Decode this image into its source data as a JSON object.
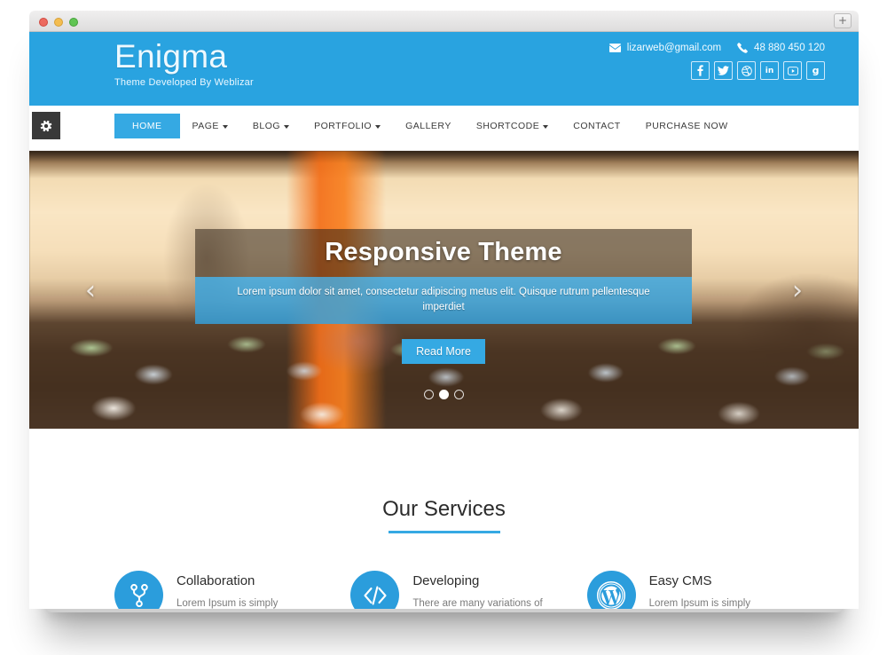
{
  "browser": {
    "traffic_lights": [
      "close",
      "minimize",
      "zoom"
    ],
    "new_tab_label": "+"
  },
  "site_header": {
    "brand_title": "Enigma",
    "brand_tagline": "Theme Developed By Weblizar",
    "email": "lizarweb@gmail.com",
    "phone": "48 880 450 120",
    "email_icon": "envelope-icon",
    "phone_icon": "phone-icon",
    "background_color": "#29a3e0",
    "social": [
      {
        "name": "facebook",
        "glyph": "f"
      },
      {
        "name": "twitter",
        "glyph": "t"
      },
      {
        "name": "dribbble",
        "glyph": "d"
      },
      {
        "name": "linkedin",
        "glyph": "in"
      },
      {
        "name": "youtube",
        "glyph": "y"
      },
      {
        "name": "googleplus",
        "glyph": "g"
      }
    ]
  },
  "nav": {
    "gear_icon": "gear-icon",
    "items": [
      {
        "label": "HOME",
        "active": true,
        "caret": false
      },
      {
        "label": "PAGE",
        "active": false,
        "caret": true
      },
      {
        "label": "BLOG",
        "active": false,
        "caret": true
      },
      {
        "label": "PORTFOLIO",
        "active": false,
        "caret": true
      },
      {
        "label": "GALLERY",
        "active": false,
        "caret": false
      },
      {
        "label": "SHORTCODE",
        "active": false,
        "caret": true
      },
      {
        "label": "CONTACT",
        "active": false,
        "caret": false
      },
      {
        "label": "PURCHASE NOW",
        "active": false,
        "caret": false
      }
    ],
    "active_color": "#35a9e3"
  },
  "hero": {
    "title": "Responsive Theme",
    "subtitle": "Lorem ipsum dolor sit amet, consectetur adipiscing metus elit. Quisque rutrum pellentesque imperdiet",
    "cta_label": "Read More",
    "prev_icon": "chevron-left-icon",
    "next_icon": "chevron-right-icon",
    "dots": [
      {
        "active": false
      },
      {
        "active": true
      },
      {
        "active": false
      }
    ],
    "accent_color": "#35a9e3"
  },
  "services": {
    "title": "Our Services",
    "underline_color": "#35a9e3",
    "items": [
      {
        "icon": "code-fork-icon",
        "name": "Collaboration",
        "desc": "Lorem Ipsum is simply"
      },
      {
        "icon": "code-icon",
        "name": "Developing",
        "desc": "There are many variations of"
      },
      {
        "icon": "wordpress-icon",
        "name": "Easy CMS",
        "desc": "Lorem Ipsum is simply"
      }
    ]
  }
}
